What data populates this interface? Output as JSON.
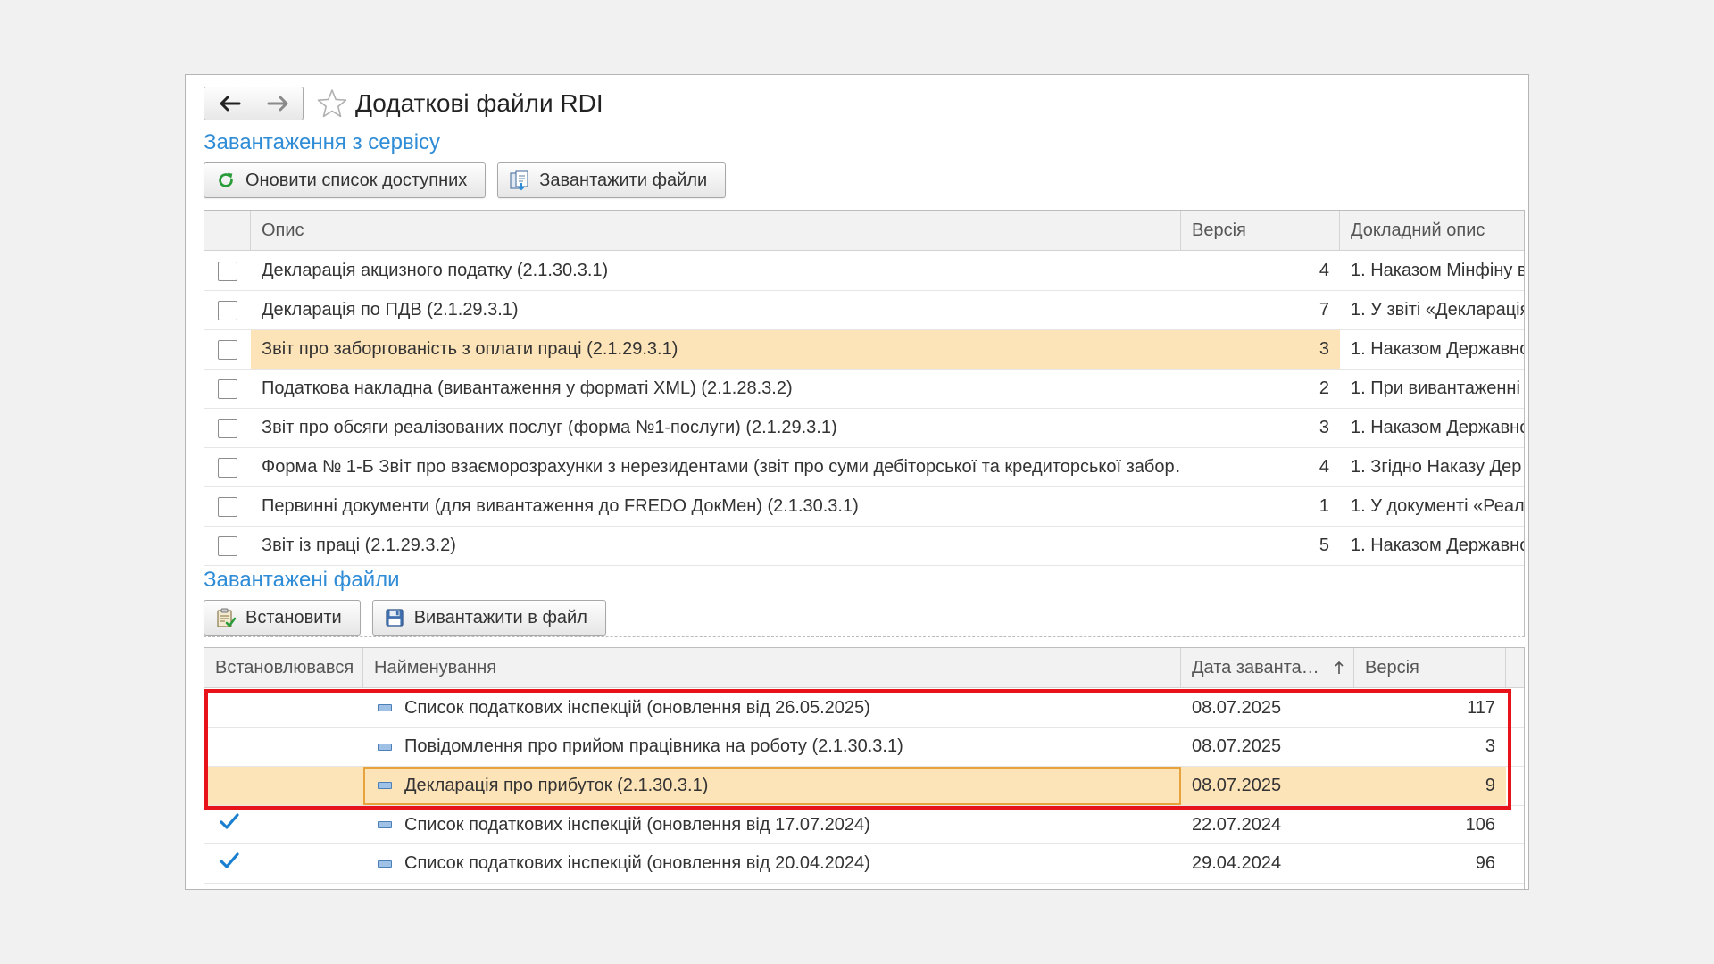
{
  "window": {
    "title": "Додаткові файли RDI"
  },
  "icons": {
    "back": "arrow-left-icon",
    "forward": "arrow-right-icon",
    "favorite": "star-icon",
    "refresh": "refresh-icon",
    "download": "download-files-icon",
    "install": "install-icon",
    "save": "floppy-disk-icon",
    "doc": "document-icon",
    "check": "checkmark-icon",
    "sort": "sort-ascending-icon"
  },
  "colors": {
    "accent": "#2f8cd6",
    "selection": "#fce3b8",
    "highlight_frame": "#e8121b",
    "check": "#1a7fd0",
    "refresh": "#2a9d3a"
  },
  "service": {
    "section_title": "Завантаження з сервісу",
    "buttons": {
      "refresh": "Оновити список доступних",
      "download": "Завантажити файли"
    },
    "columns": {
      "description": "Опис",
      "version": "Версія",
      "details": "Докладний опис"
    },
    "rows": [
      {
        "description": "Декларація акцизного податку (2.1.30.3.1)",
        "version": "4",
        "details": "1. Наказом Мінфіну в"
      },
      {
        "description": "Декларація по ПДВ (2.1.29.3.1)",
        "version": "7",
        "details": "1. У звіті «Декларація"
      },
      {
        "description": "Звіт про заборгованість з оплати праці (2.1.29.3.1)",
        "version": "3",
        "details": "1. Наказом Державно"
      },
      {
        "description": "Податкова накладна (вивантаження у форматі XML) (2.1.28.3.2)",
        "version": "2",
        "details": "1. При вивантаженні"
      },
      {
        "description": "Звіт про обсяги реалізованих послуг (форма №1-послуги) (2.1.29.3.1)",
        "version": "3",
        "details": "1. Наказом Державно"
      },
      {
        "description": "Форма № 1-Б Звіт про взаєморозрахунки з нерезидентами (звіт про суми дебіторської та кредиторської забор…",
        "version": "4",
        "details": "1. Згідно Наказу Дер"
      },
      {
        "description": "Первинні документи (для вивантаження до FREDO ДокМен) (2.1.30.3.1)",
        "version": "1",
        "details": "1. У документі «Реал"
      },
      {
        "description": "Звіт із праці (2.1.29.3.2)",
        "version": "5",
        "details": "1. Наказом Державно"
      }
    ]
  },
  "downloaded": {
    "section_title": "Завантажені файли",
    "buttons": {
      "install": "Встановити",
      "export": "Вивантажити в файл"
    },
    "columns": {
      "installed": "Встановлювався",
      "name": "Найменування",
      "date": "Дата заванта…",
      "version": "Версія"
    },
    "rows": [
      {
        "installed": false,
        "name": "Список податкових інспекцій (оновлення від 26.05.2025)",
        "date": "08.07.2025",
        "version": "117"
      },
      {
        "installed": false,
        "name": "Повідомлення про прийом працівника на роботу (2.1.30.3.1)",
        "date": "08.07.2025",
        "version": "3"
      },
      {
        "installed": false,
        "name": "Декларація про прибуток (2.1.30.3.1)",
        "date": "08.07.2025",
        "version": "9"
      },
      {
        "installed": true,
        "name": "Список податкових інспекцій (оновлення від 17.07.2024)",
        "date": "22.07.2024",
        "version": "106"
      },
      {
        "installed": true,
        "name": "Список податкових інспекцій (оновлення від 20.04.2024)",
        "date": "29.04.2024",
        "version": "96"
      }
    ]
  }
}
